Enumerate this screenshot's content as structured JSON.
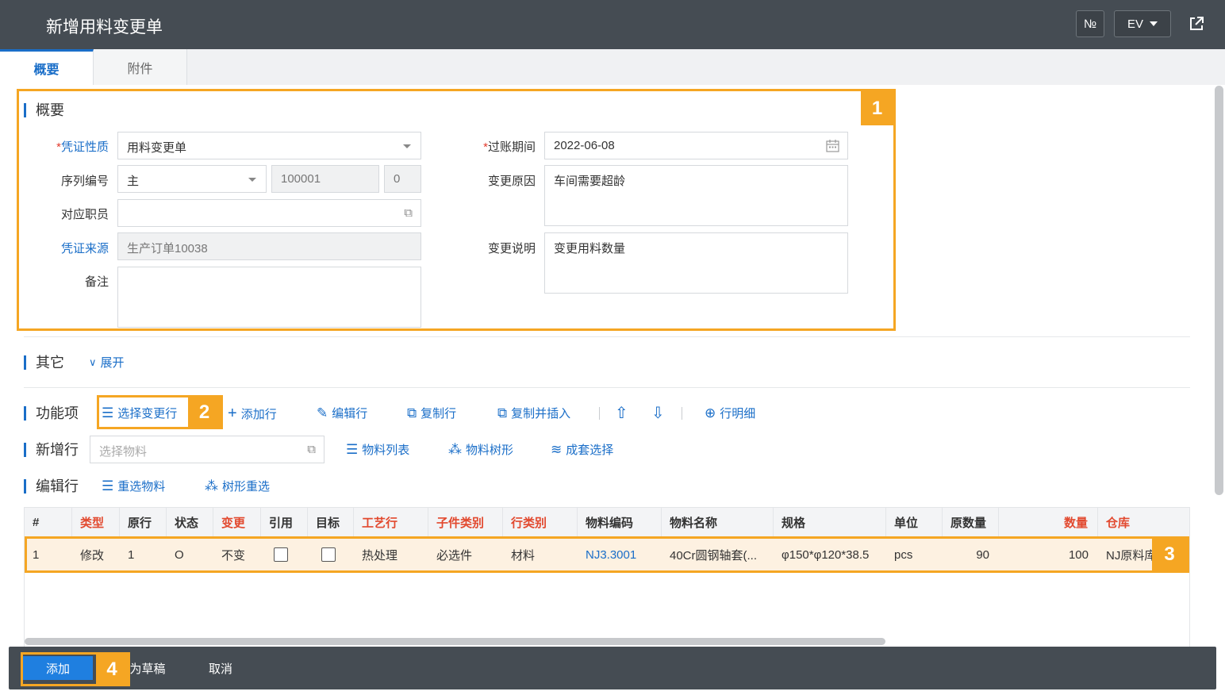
{
  "window": {
    "title": "新增用料变更单",
    "buttons": {
      "numbering": "№",
      "lang": "EV"
    }
  },
  "tabs": [
    {
      "label": "概要",
      "active": true
    },
    {
      "label": "附件",
      "active": false
    }
  ],
  "summary": {
    "heading": "概要",
    "fields": {
      "voucher_type": {
        "label": "凭证性质",
        "required": "*",
        "value": "用料变更单"
      },
      "serial": {
        "label": "序列编号",
        "value": "主",
        "number": "100001",
        "suffix": "0"
      },
      "employee": {
        "label": "对应职员",
        "value": ""
      },
      "source": {
        "label": "凭证来源",
        "value": "生产订单10038"
      },
      "remark": {
        "label": "备注",
        "value": ""
      },
      "post_date": {
        "label": "过账期间",
        "required": "*",
        "value": "2022-06-08"
      },
      "reason": {
        "label": "变更原因",
        "value": "车间需要超龄"
      },
      "note": {
        "label": "变更说明",
        "value": "变更用料数量"
      }
    }
  },
  "other": {
    "heading": "其它",
    "expand": "展开"
  },
  "functions": {
    "heading": "功能项",
    "select_change_row": "选择变更行",
    "add_row": "添加行",
    "edit_row": "编辑行",
    "copy_row": "复制行",
    "copy_insert": "复制并插入",
    "row_detail": "行明细"
  },
  "new_row": {
    "heading": "新增行",
    "material_placeholder": "选择物料",
    "material_list": "物料列表",
    "material_tree": "物料树形",
    "set_select": "成套选择"
  },
  "edit_row": {
    "heading": "编辑行",
    "reselect": "重选物料",
    "tree_reselect": "树形重选"
  },
  "grid": {
    "columns": [
      "#",
      "类型",
      "原行",
      "状态",
      "变更",
      "引用",
      "目标",
      "工艺行",
      "子件类别",
      "行类别",
      "物料编码",
      "物料名称",
      "规格",
      "单位",
      "原数量",
      "数量",
      "仓库"
    ],
    "rows": [
      {
        "no": "1",
        "type": "修改",
        "orig_row": "1",
        "status": "O",
        "change": "不变",
        "ref": false,
        "target": false,
        "process": "热处理",
        "sub_type": "必选件",
        "row_type": "材料",
        "code": "NJ3.3001",
        "name": "40Cr圆钢轴套(...",
        "spec": "φ150*φ120*38.5",
        "unit": "pcs",
        "orig_qty": "90",
        "qty": "100",
        "warehouse": "NJ原料库"
      }
    ]
  },
  "footer": {
    "add": "添加",
    "draft": "为草稿",
    "cancel": "取消"
  },
  "badges": [
    "1",
    "2",
    "3",
    "4"
  ],
  "colors": {
    "accent": "#1a6ec8",
    "highlight": "#f5a623",
    "header_bg": "#454c53",
    "required": "#e23b2e"
  }
}
